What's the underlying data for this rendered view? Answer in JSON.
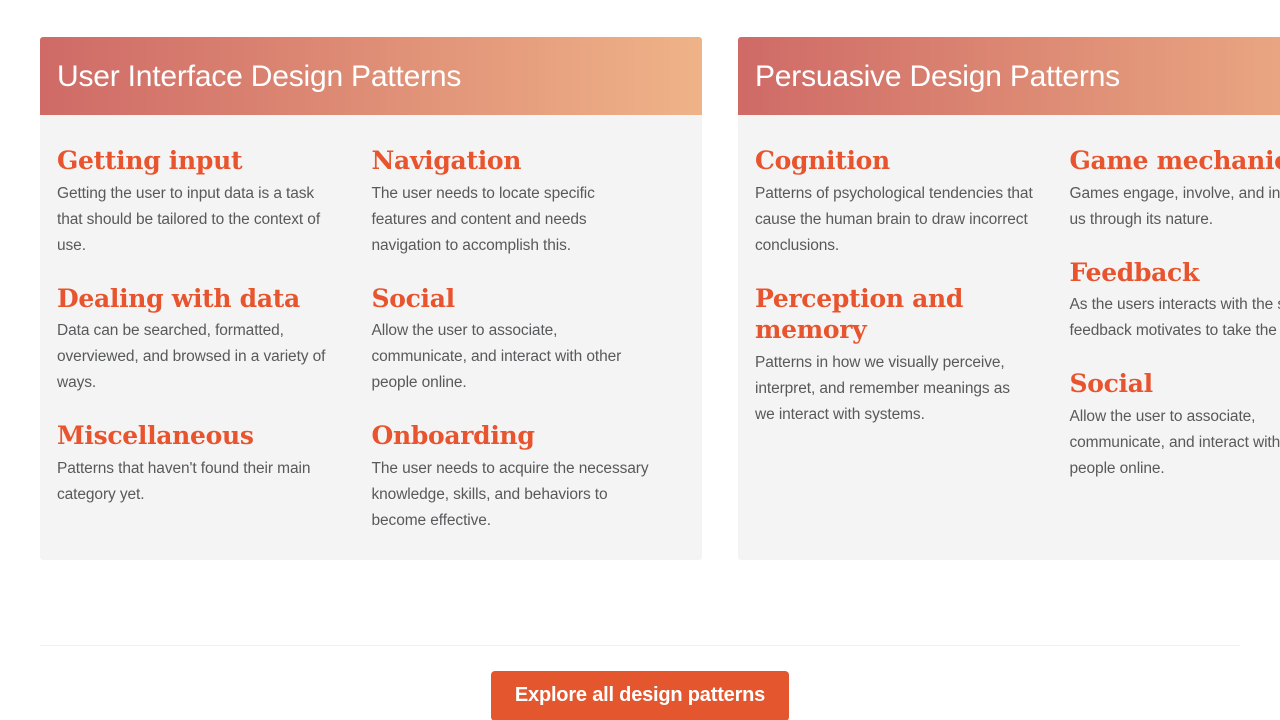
{
  "page": {
    "background_color": "#ffffff",
    "accent_color": "#e8542e",
    "card_background_color": "#f4f4f4",
    "header_gradient_from": "#cf6a67",
    "header_gradient_to": "#efb388"
  },
  "cards": [
    {
      "title": "User Interface Design Patterns",
      "columns": [
        {
          "items": [
            {
              "title": "Getting input",
              "description": "Getting the user to input data is a task that should be tailored to the context of use."
            },
            {
              "title": "Dealing with data",
              "description": "Data can be searched, formatted, overviewed, and browsed in a variety of ways."
            },
            {
              "title": "Miscellaneous",
              "description": "Patterns that haven't found their main category yet."
            }
          ]
        },
        {
          "items": [
            {
              "title": "Navigation",
              "description": "The user needs to locate specific features and content and needs navigation to accomplish this."
            },
            {
              "title": "Social",
              "description": "Allow the user to associate, communicate, and interact with other people online."
            },
            {
              "title": "Onboarding",
              "description": "The user needs to acquire the necessary knowledge, skills, and behaviors to become effective."
            }
          ]
        }
      ]
    },
    {
      "title": "Persuasive Design Patterns",
      "columns": [
        {
          "items": [
            {
              "title": "Cognition",
              "description": "Patterns of psychological tendencies that cause the human brain to draw incorrect conclusions."
            },
            {
              "title": "Perception and memory",
              "description": "Patterns in how we visually perceive, interpret, and remember meanings as we interact with systems."
            },
            {
              "title": "",
              "description": ""
            }
          ]
        },
        {
          "items": [
            {
              "title": "Game mechanics",
              "description": "Games engage, involve, and influence us through its nature."
            },
            {
              "title": "Feedback",
              "description": "As the users interacts with the system feedback motivates to take the next step."
            },
            {
              "title": "Social",
              "description": "Allow the user to associate, communicate, and interact with other people online."
            }
          ]
        }
      ]
    }
  ],
  "footer": {
    "cta_label": "Explore all design patterns",
    "cta_color": "#e4572e"
  }
}
